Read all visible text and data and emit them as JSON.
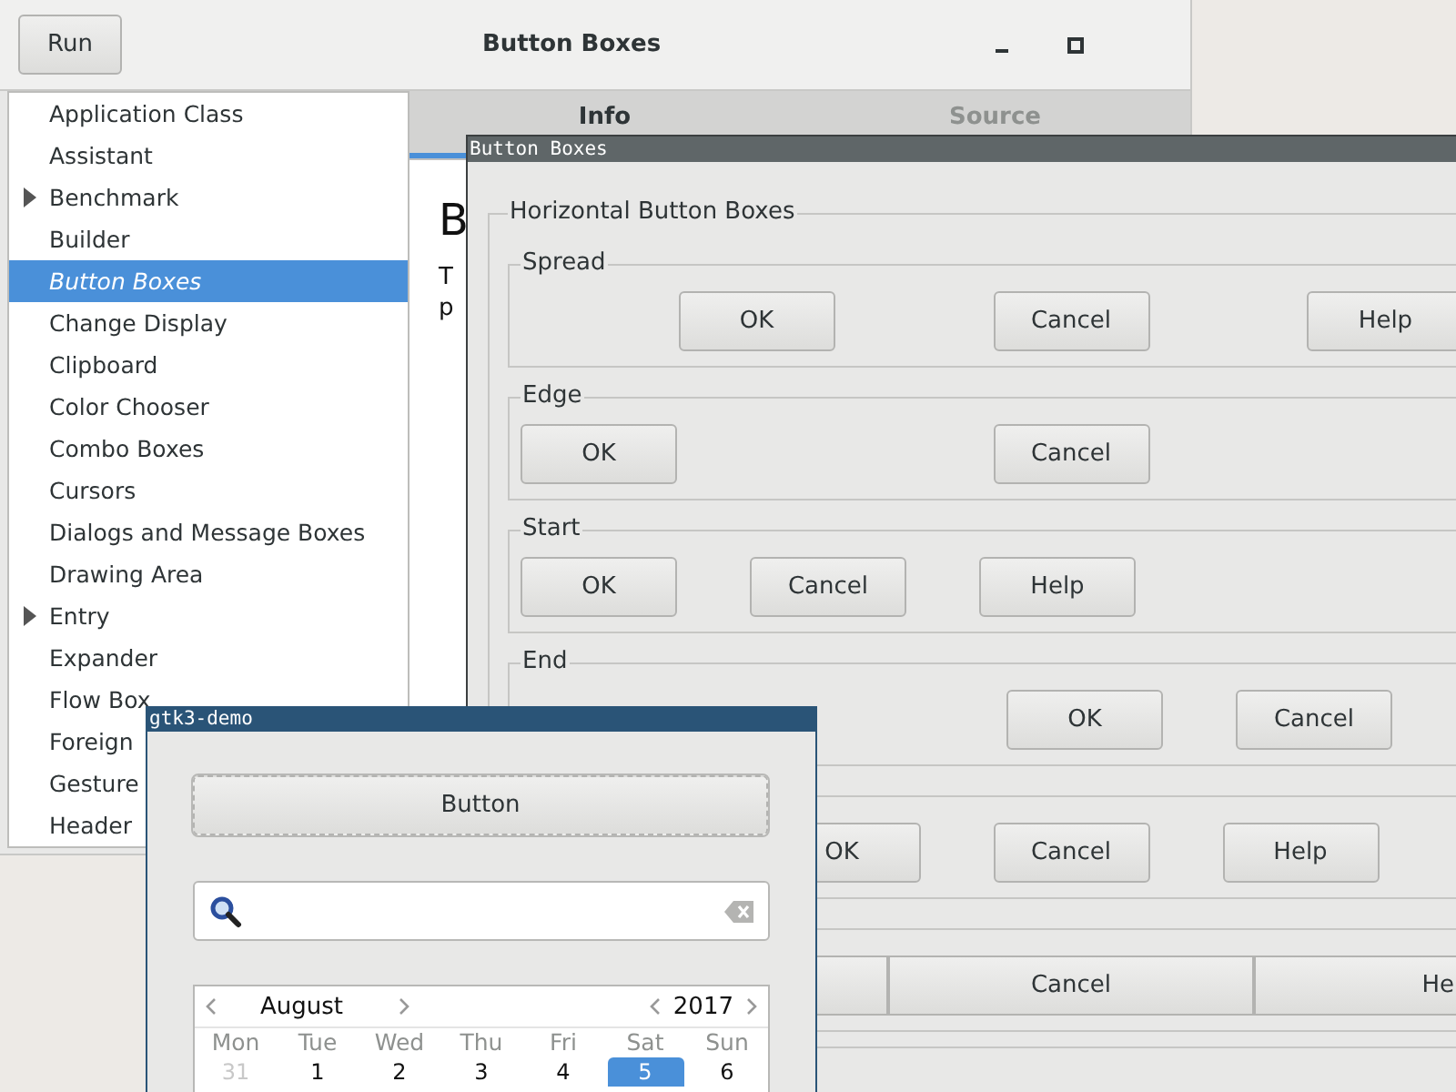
{
  "main_window": {
    "title": "Button Boxes",
    "run_button": "Run",
    "sidebar": {
      "items": [
        {
          "label": "Application Class",
          "expandable": false,
          "selected": false
        },
        {
          "label": "Assistant",
          "expandable": false,
          "selected": false
        },
        {
          "label": "Benchmark",
          "expandable": true,
          "selected": false
        },
        {
          "label": "Builder",
          "expandable": false,
          "selected": false
        },
        {
          "label": "Button Boxes",
          "expandable": false,
          "selected": true
        },
        {
          "label": "Change Display",
          "expandable": false,
          "selected": false
        },
        {
          "label": "Clipboard",
          "expandable": false,
          "selected": false
        },
        {
          "label": "Color Chooser",
          "expandable": false,
          "selected": false
        },
        {
          "label": "Combo Boxes",
          "expandable": false,
          "selected": false
        },
        {
          "label": "Cursors",
          "expandable": false,
          "selected": false
        },
        {
          "label": "Dialogs and Message Boxes",
          "expandable": false,
          "selected": false
        },
        {
          "label": "Drawing Area",
          "expandable": false,
          "selected": false
        },
        {
          "label": "Entry",
          "expandable": true,
          "selected": false
        },
        {
          "label": "Expander",
          "expandable": false,
          "selected": false
        },
        {
          "label": "Flow Box",
          "expandable": false,
          "selected": false
        },
        {
          "label": "Foreign",
          "expandable": false,
          "selected": false
        },
        {
          "label": "Gesture",
          "expandable": false,
          "selected": false
        },
        {
          "label": "Header",
          "expandable": false,
          "selected": false
        }
      ]
    },
    "tabs": [
      {
        "label": "Info",
        "selected": true
      },
      {
        "label": "Source",
        "selected": false
      }
    ],
    "info": {
      "heading": "B",
      "lines": [
        "T",
        "p"
      ]
    }
  },
  "button_boxes_window": {
    "title": "Button Boxes",
    "frame": {
      "label": "Horizontal Button Boxes",
      "boxes": [
        {
          "label": "Spread",
          "kind": "spread",
          "buttons": [
            {
              "kind": "button",
              "label": "OK"
            },
            {
              "kind": "button",
              "label": "Cancel"
            },
            {
              "kind": "button",
              "label": "Help"
            }
          ]
        },
        {
          "label": "Edge",
          "kind": "edge",
          "buttons": [
            {
              "kind": "button",
              "label": "OK"
            },
            {
              "kind": "button",
              "label": "Cancel"
            }
          ]
        },
        {
          "label": "Start",
          "kind": "start",
          "buttons": [
            {
              "kind": "button",
              "label": "OK"
            },
            {
              "kind": "button",
              "label": "Cancel"
            },
            {
              "kind": "button",
              "label": "Help"
            }
          ]
        },
        {
          "label": "End",
          "kind": "end",
          "buttons": [
            {
              "kind": "button",
              "label": "OK"
            },
            {
              "kind": "button",
              "label": "Cancel"
            }
          ]
        },
        {
          "kind": "center",
          "buttons": [
            {
              "kind": "button",
              "label": "OK"
            },
            {
              "kind": "button",
              "label": "Cancel"
            },
            {
              "kind": "button",
              "label": "Help"
            }
          ]
        },
        {
          "kind": "expand",
          "buttons": [
            {
              "kind": "button"
            },
            {
              "kind": "button",
              "label": "Cancel"
            },
            {
              "kind": "button",
              "label": "He"
            }
          ]
        }
      ]
    }
  },
  "demo_window": {
    "title": "gtk3-demo",
    "button": "Button",
    "calendar": {
      "month": "August",
      "year": "2017",
      "weekdays": [
        "Mon",
        "Tue",
        "Wed",
        "Thu",
        "Fri",
        "Sat",
        "Sun"
      ],
      "days": [
        {
          "label": "31",
          "other_month": true,
          "selected": false
        },
        {
          "label": "1",
          "other_month": false,
          "selected": false
        },
        {
          "label": "2",
          "other_month": false,
          "selected": false
        },
        {
          "label": "3",
          "other_month": false,
          "selected": false
        },
        {
          "label": "4",
          "other_month": false,
          "selected": false
        },
        {
          "label": "5",
          "other_month": false,
          "selected": true
        },
        {
          "label": "6",
          "other_month": false,
          "selected": false
        }
      ]
    }
  }
}
